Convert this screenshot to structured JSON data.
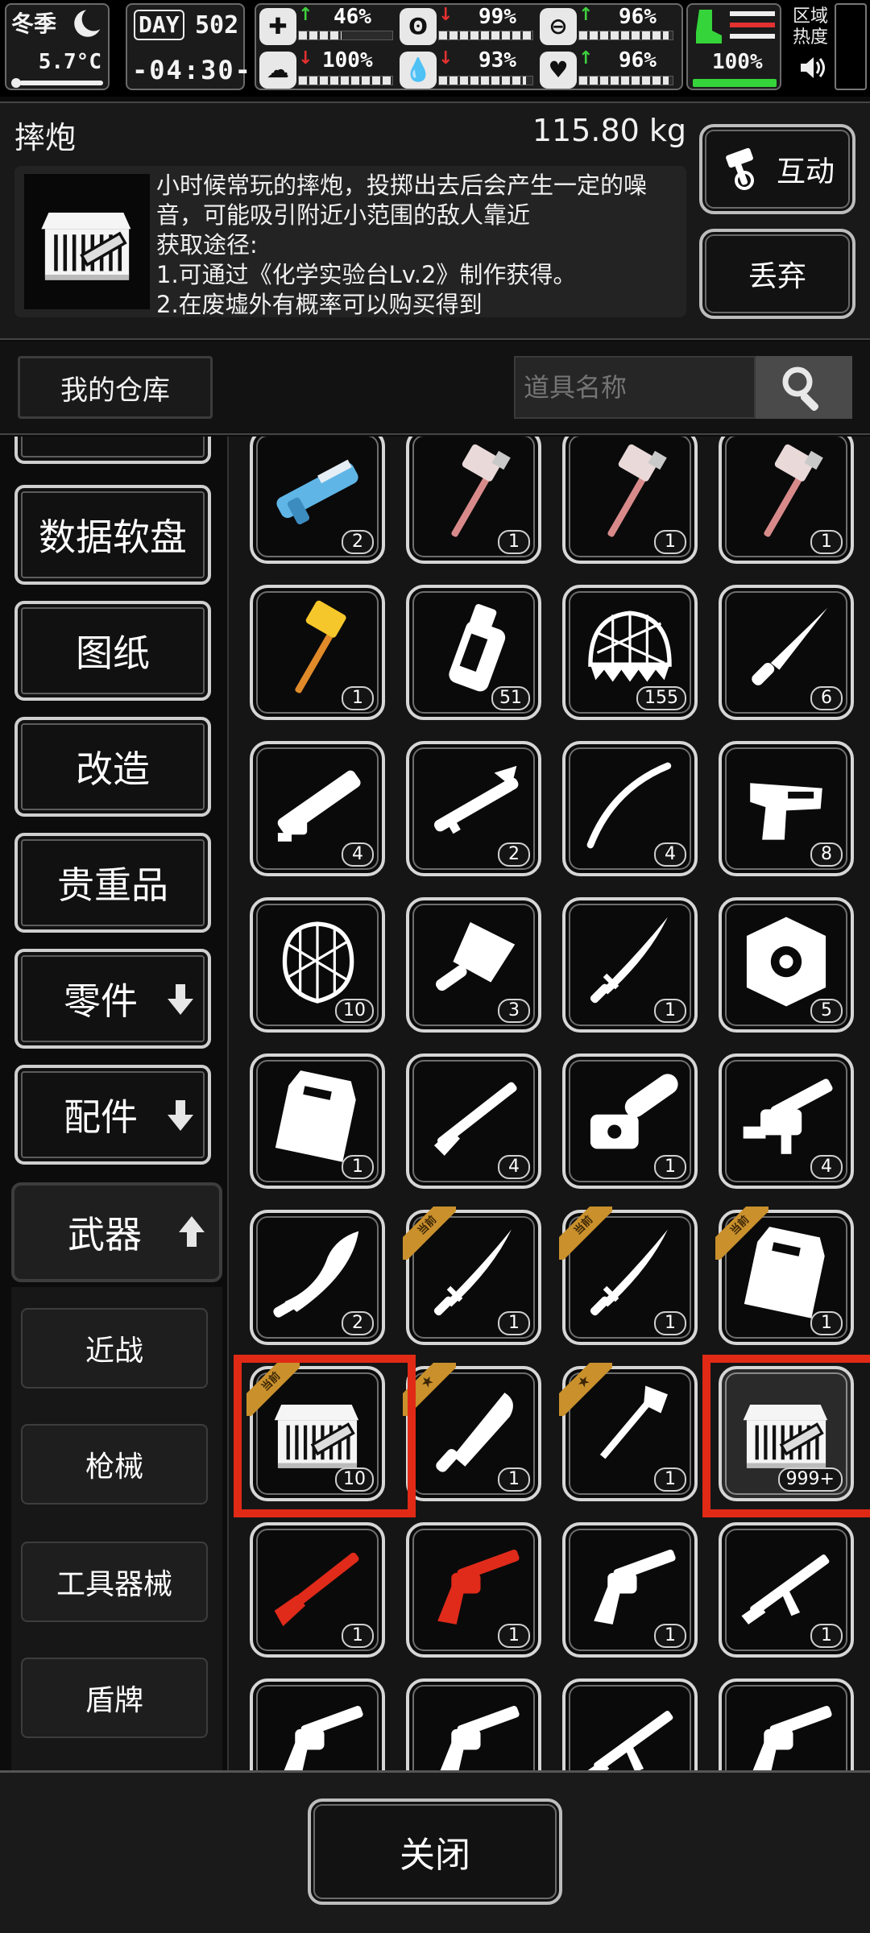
{
  "status": {
    "season": "冬季",
    "temperature": "5.7°C",
    "day_label": "DAY",
    "day_number": "502",
    "clock": "-04:30-",
    "zone_heat_label": "区域热度",
    "health": {
      "value": "46%",
      "trend": "up",
      "level": 0.46
    },
    "stomach": {
      "value": "99%",
      "trend": "down",
      "level": 0.99
    },
    "sanity": {
      "value": "96%",
      "trend": "up",
      "level": 0.96
    },
    "stamina": {
      "value": "100%",
      "trend": "down",
      "level": 1.0
    },
    "water": {
      "value": "93%",
      "trend": "down",
      "level": 0.93
    },
    "heart": {
      "value": "96%",
      "trend": "up",
      "level": 0.96
    },
    "equip_durability": {
      "value": "100%",
      "level": 1.0
    }
  },
  "item_detail": {
    "name": "摔炮",
    "weight": "115.80 kg",
    "description_lines": [
      "小时候常玩的摔炮，投掷出去后会产生一定的噪",
      "音，可能吸引附近小范围的敌人靠近",
      "获取途径:",
      "1.可通过《化学实验台Lv.2》制作获得。",
      "2.在废墟外有概率可以购买得到"
    ],
    "interact_label": "互动",
    "discard_label": "丢弃"
  },
  "warehouse": {
    "tab_label": "我的仓库",
    "search_placeholder": "道具名称"
  },
  "categories": [
    {
      "label": "数据软盘"
    },
    {
      "label": "图纸"
    },
    {
      "label": "改造"
    },
    {
      "label": "贵重品"
    },
    {
      "label": "零件",
      "arrow": "down"
    },
    {
      "label": "配件",
      "arrow": "down"
    },
    {
      "label": "武器",
      "arrow": "up",
      "active": true
    }
  ],
  "subcategories": [
    {
      "label": "近战"
    },
    {
      "label": "枪械"
    },
    {
      "label": "工具器械"
    },
    {
      "label": "盾牌"
    }
  ],
  "inventory": [
    {
      "icon": "blue-rifle-icon",
      "qty": "2"
    },
    {
      "icon": "war-hammer-icon",
      "qty": "1"
    },
    {
      "icon": "war-hammer-icon",
      "qty": "1"
    },
    {
      "icon": "war-hammer-icon",
      "qty": "1"
    },
    {
      "icon": "golden-hammer-icon",
      "qty": "1"
    },
    {
      "icon": "bottle-icon",
      "qty": "51"
    },
    {
      "icon": "spiked-net-icon",
      "qty": "155"
    },
    {
      "icon": "knife-icon",
      "qty": "6"
    },
    {
      "icon": "gatling-gun-icon",
      "qty": "4"
    },
    {
      "icon": "rocket-launcher-icon",
      "qty": "2"
    },
    {
      "icon": "whip-icon",
      "qty": "4"
    },
    {
      "icon": "taser-icon",
      "qty": "8"
    },
    {
      "icon": "net-icon",
      "qty": "10"
    },
    {
      "icon": "cleaver-icon",
      "qty": "3"
    },
    {
      "icon": "katana-icon",
      "qty": "1"
    },
    {
      "icon": "round-shield-icon",
      "qty": "5"
    },
    {
      "icon": "riot-shield-icon",
      "qty": "1"
    },
    {
      "icon": "shotgun-icon",
      "qty": "4"
    },
    {
      "icon": "chainsaw-icon",
      "qty": "1"
    },
    {
      "icon": "grenade-launcher-icon",
      "qty": "4"
    },
    {
      "icon": "kukri-icon",
      "qty": "2"
    },
    {
      "icon": "katana-icon",
      "qty": "1",
      "tag": "当前"
    },
    {
      "icon": "katana-icon",
      "qty": "1",
      "tag": "当前"
    },
    {
      "icon": "riot-shield-icon",
      "qty": "1",
      "tag": "当前"
    },
    {
      "icon": "firecracker-box-icon",
      "qty": "10",
      "tag": "当前",
      "highlight": true
    },
    {
      "icon": "machete-icon",
      "qty": "1",
      "star": true
    },
    {
      "icon": "shovel-icon",
      "qty": "1",
      "star": true
    },
    {
      "icon": "firecracker-box-icon",
      "qty": "999+",
      "highlight": true,
      "selected": true
    },
    {
      "icon": "red-rifle-icon",
      "qty": "1"
    },
    {
      "icon": "red-revolver-icon",
      "qty": "1"
    },
    {
      "icon": "revolver-icon",
      "qty": "1"
    },
    {
      "icon": "assault-rifle-icon",
      "qty": "1"
    },
    {
      "icon": "revolver-icon",
      "qty": ""
    },
    {
      "icon": "revolver-icon",
      "qty": ""
    },
    {
      "icon": "assault-rifle-icon",
      "qty": ""
    },
    {
      "icon": "revolver-icon",
      "qty": ""
    }
  ],
  "close_label": "关闭",
  "colors": {
    "highlight": "#e02a16",
    "tag": "#c9902c",
    "trend_up": "#3fd13f",
    "trend_down": "#e33131",
    "durability": "#35d43a"
  }
}
